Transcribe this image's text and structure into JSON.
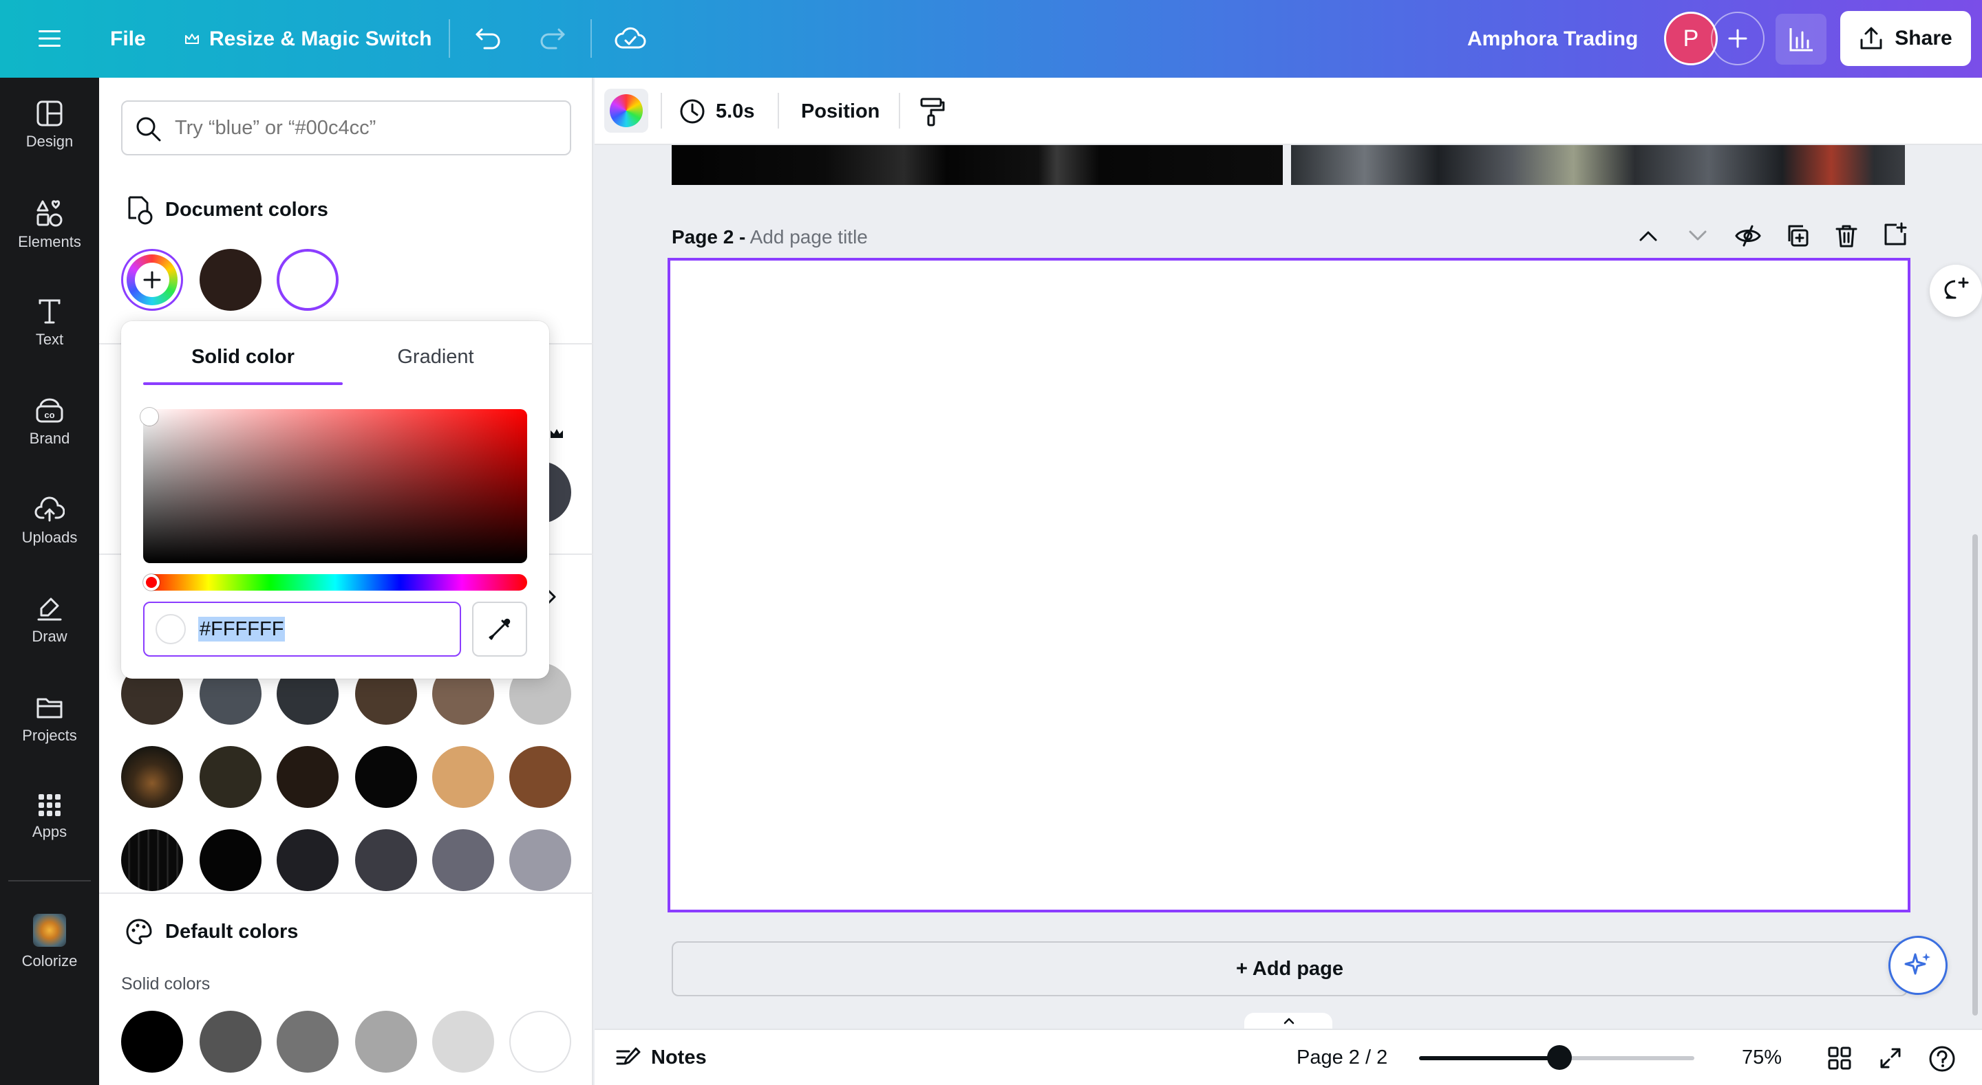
{
  "topbar": {
    "file_label": "File",
    "resize_label": "Resize & Magic Switch",
    "project_name": "Amphora Trading",
    "avatar_letter": "P",
    "share_label": "Share"
  },
  "rail": {
    "items": [
      {
        "label": "Design",
        "icon": "design-icon"
      },
      {
        "label": "Elements",
        "icon": "elements-icon"
      },
      {
        "label": "Text",
        "icon": "text-icon"
      },
      {
        "label": "Brand",
        "icon": "brand-icon"
      },
      {
        "label": "Uploads",
        "icon": "uploads-icon"
      },
      {
        "label": "Draw",
        "icon": "draw-icon"
      },
      {
        "label": "Projects",
        "icon": "projects-icon"
      },
      {
        "label": "Apps",
        "icon": "apps-icon"
      },
      {
        "label": "Colorize",
        "icon": "colorize-app-icon"
      }
    ]
  },
  "panel": {
    "search_placeholder": "Try “blue” or “#00c4cc”",
    "document_colors_title": "Document colors",
    "document_colors": [
      "#2b1d18",
      "#ffffff"
    ],
    "photo_colors_row1": [
      "#2e2a1f",
      "#231912",
      "#070707",
      "#d8a36a",
      "#7d4a2a"
    ],
    "photo_colors_row2": [
      "#050505",
      "#1f1f24",
      "#3b3b43",
      "#676774",
      "#9a9aa6"
    ],
    "default_colors_title": "Default colors",
    "solid_colors_label": "Solid colors",
    "solid_colors": [
      "#000000",
      "#545454",
      "#737373",
      "#a6a6a6",
      "#d9d9d9",
      "#ffffff"
    ]
  },
  "color_popup": {
    "tab_solid": "Solid color",
    "tab_gradient": "Gradient",
    "hex_value": "#FFFFFF",
    "active_tab": "Solid color"
  },
  "canvas_toolbar": {
    "duration": "5.0s",
    "position_label": "Position"
  },
  "canvas": {
    "page_label": "Page 2 -",
    "page_title_placeholder": "Add page title",
    "add_page_label": "+ Add page"
  },
  "bottombar": {
    "notes_label": "Notes",
    "page_indicator": "Page 2 / 2",
    "zoom_level": "75%",
    "zoom_fraction": 0.51
  },
  "colors": {
    "accent": "#8b3dff",
    "rail_bg": "#18191b",
    "avatar_bg": "#e23f6f"
  }
}
